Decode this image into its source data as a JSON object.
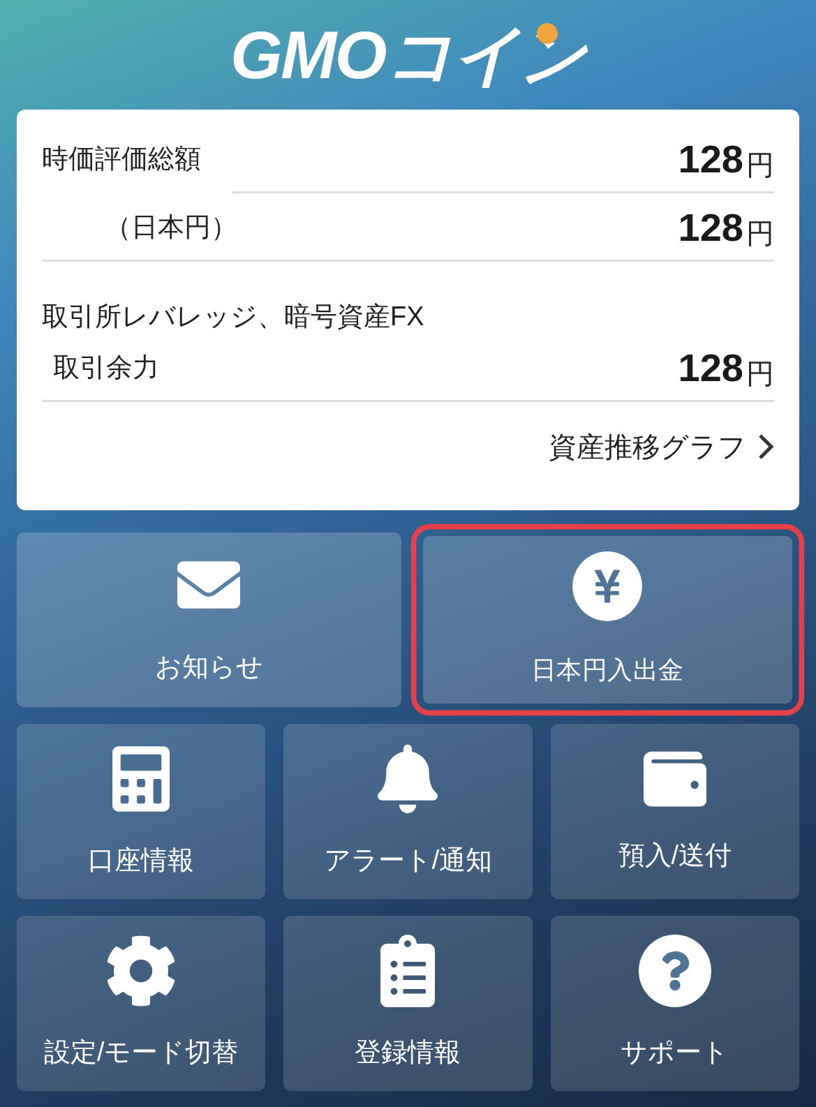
{
  "logo": {
    "text": "GMOコイン"
  },
  "summary": {
    "rows": [
      {
        "label": "時価評価総額",
        "value": "128",
        "unit": "円"
      },
      {
        "label": "（日本円）",
        "value": "128",
        "unit": "円"
      }
    ],
    "margin": {
      "title": "取引所レバレッジ、暗号資産FX",
      "label": "取引余力",
      "value": "128",
      "unit": "円"
    },
    "link": "資産推移グラフ"
  },
  "tiles": [
    {
      "label": "お知らせ",
      "highlighted": false
    },
    {
      "label": "日本円入出金",
      "highlighted": true
    }
  ],
  "grid": [
    {
      "label": "口座情報"
    },
    {
      "label": "アラート/通知"
    },
    {
      "label": "預入/送付"
    },
    {
      "label": "設定/モード切替"
    },
    {
      "label": "登録情報"
    },
    {
      "label": "サポート"
    }
  ]
}
